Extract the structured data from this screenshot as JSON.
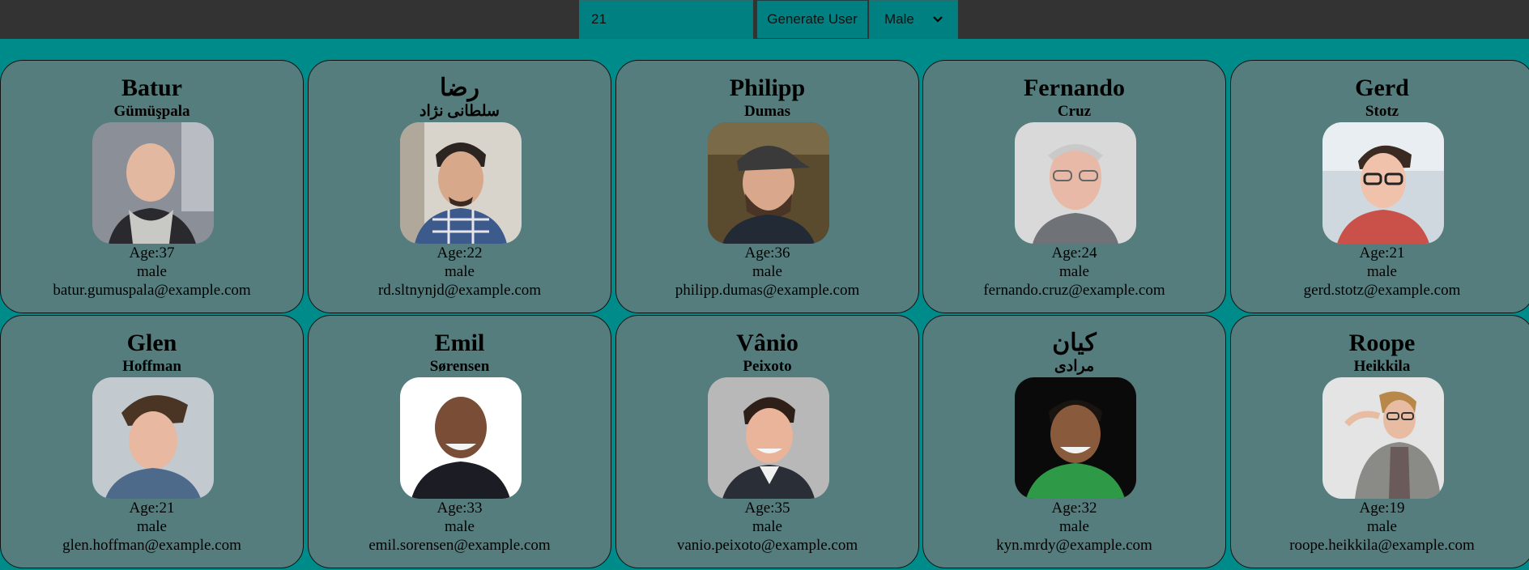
{
  "controls": {
    "count_value": "21",
    "generate_label": "Generate User",
    "gender_selected": "Male"
  },
  "colors": {
    "page_background": "#008b8b",
    "topbar_background": "#333333",
    "control_background": "#008080",
    "card_background": "#567d7d"
  },
  "users": [
    {
      "first": "Batur",
      "last": "Gümüşpala",
      "age": "Age:37",
      "gender": "male",
      "email": "batur.gumuspala@example.com"
    },
    {
      "first": "رضا",
      "last": "سلطانی نژاد",
      "age": "Age:22",
      "gender": "male",
      "email": "rd.sltnynjd@example.com"
    },
    {
      "first": "Philipp",
      "last": "Dumas",
      "age": "Age:36",
      "gender": "male",
      "email": "philipp.dumas@example.com"
    },
    {
      "first": "Fernando",
      "last": "Cruz",
      "age": "Age:24",
      "gender": "male",
      "email": "fernando.cruz@example.com"
    },
    {
      "first": "Gerd",
      "last": "Stotz",
      "age": "Age:21",
      "gender": "male",
      "email": "gerd.stotz@example.com"
    },
    {
      "first": "Glen",
      "last": "Hoffman",
      "age": "Age:21",
      "gender": "male",
      "email": "glen.hoffman@example.com"
    },
    {
      "first": "Emil",
      "last": "Sørensen",
      "age": "Age:33",
      "gender": "male",
      "email": "emil.sorensen@example.com"
    },
    {
      "first": "Vânio",
      "last": "Peixoto",
      "age": "Age:35",
      "gender": "male",
      "email": "vanio.peixoto@example.com"
    },
    {
      "first": "کیان",
      "last": "مرادی",
      "age": "Age:32",
      "gender": "male",
      "email": "kyn.mrdy@example.com"
    },
    {
      "first": "Roope",
      "last": "Heikkila",
      "age": "Age:19",
      "gender": "male",
      "email": "roope.heikkila@example.com"
    }
  ]
}
